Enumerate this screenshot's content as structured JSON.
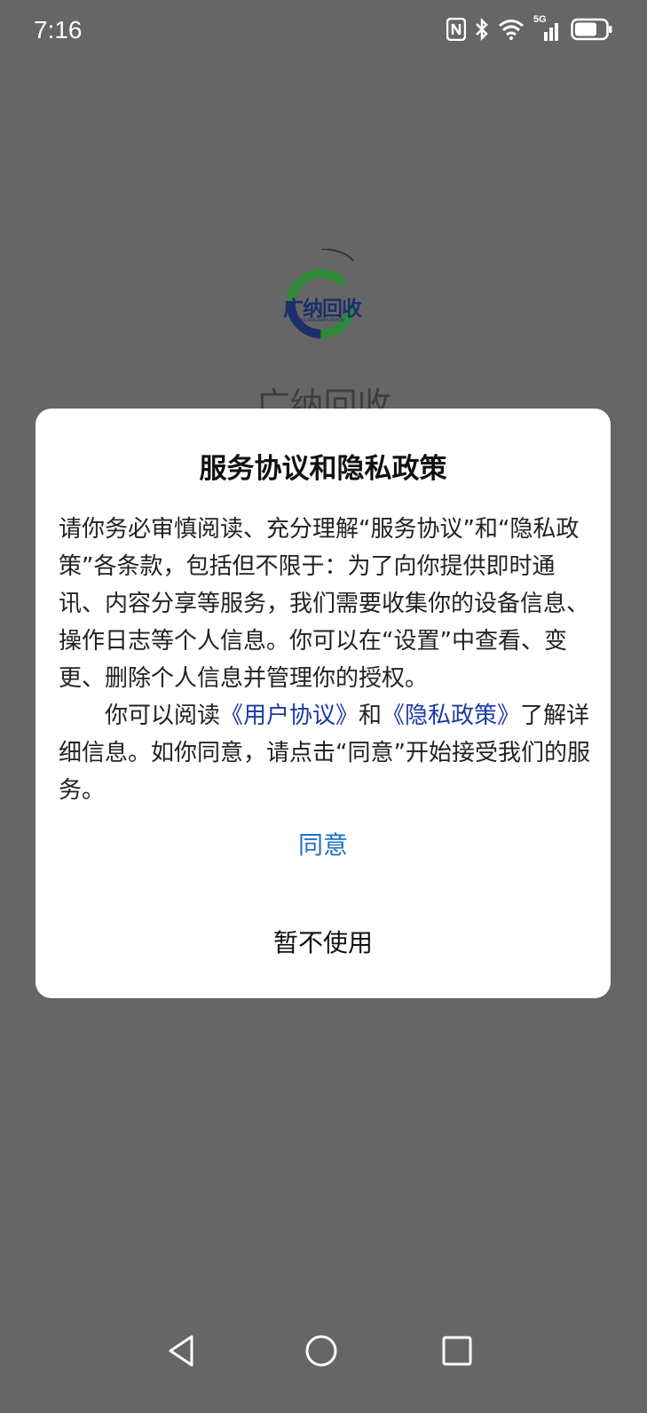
{
  "status_bar": {
    "time": "7:16",
    "icons": [
      "nfc-icon",
      "bluetooth-icon",
      "wifi-icon",
      "5g-signal-icon",
      "battery-icon"
    ],
    "network_label": "5G"
  },
  "splash": {
    "logo_text": "广纳回收",
    "logo_subtext": "GUANGNAHUISHOU",
    "app_name": "广纳回收"
  },
  "dialog": {
    "title": "服务协议和隐私政策",
    "paragraph1": "请你务必审慎阅读、充分理解“服务协议”和“隐私政策”各条款，包括但不限于：为了向你提供即时通讯、内容分享等服务，我们需要收集你的设备信息、操作日志等个人信息。你可以在“设置”中查看、变更、删除个人信息并管理你的授权。",
    "paragraph2_pre": "你可以阅读",
    "user_agreement_link": "《用户协议》",
    "paragraph2_mid": "和",
    "privacy_policy_link": "《隐私政策》",
    "paragraph2_post": "了解详细信息。如你同意，请点击“同意”开始接受我们的服务。",
    "agree_label": "同意",
    "decline_label": "暂不使用"
  },
  "colors": {
    "overlay": "#666666",
    "link": "#1c3aa3",
    "agree": "#1f72c4",
    "logo_green": "#2f8a3a",
    "logo_navy": "#1c2f6b"
  }
}
